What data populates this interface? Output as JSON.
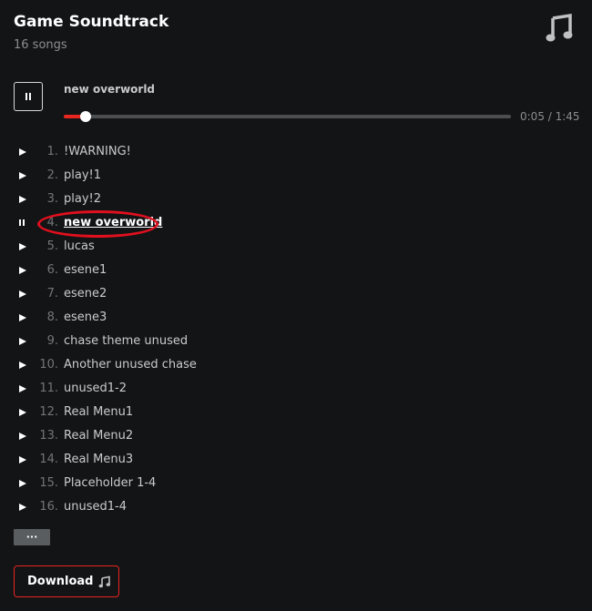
{
  "header": {
    "title": "Game Soundtrack",
    "subtitle": "16 songs",
    "icon": "music-note-icon"
  },
  "player": {
    "now_playing": "new overworld",
    "time": "0:05 / 1:45",
    "progress_fraction": 0.048,
    "state": "playing"
  },
  "tracks": [
    {
      "num": "1.",
      "name": "!WARNING!"
    },
    {
      "num": "2.",
      "name": "play!1"
    },
    {
      "num": "3.",
      "name": "play!2"
    },
    {
      "num": "4.",
      "name": "new overworld",
      "active": true
    },
    {
      "num": "5.",
      "name": "lucas"
    },
    {
      "num": "6.",
      "name": "esene1"
    },
    {
      "num": "7.",
      "name": "esene2"
    },
    {
      "num": "8.",
      "name": "esene3"
    },
    {
      "num": "9.",
      "name": "chase theme unused"
    },
    {
      "num": "10.",
      "name": "Another unused chase"
    },
    {
      "num": "11.",
      "name": "unused1-2"
    },
    {
      "num": "12.",
      "name": "Real Menu1"
    },
    {
      "num": "13.",
      "name": "Real Menu2"
    },
    {
      "num": "14.",
      "name": "Real Menu3"
    },
    {
      "num": "15.",
      "name": "Placeholder 1-4"
    },
    {
      "num": "16.",
      "name": "unused1-4"
    }
  ],
  "more_label": "···",
  "download": {
    "label": "Download",
    "icon": "music-note-icon"
  },
  "colors": {
    "accent": "#e8251e",
    "background": "#121416",
    "annotation": "#e0101e"
  }
}
